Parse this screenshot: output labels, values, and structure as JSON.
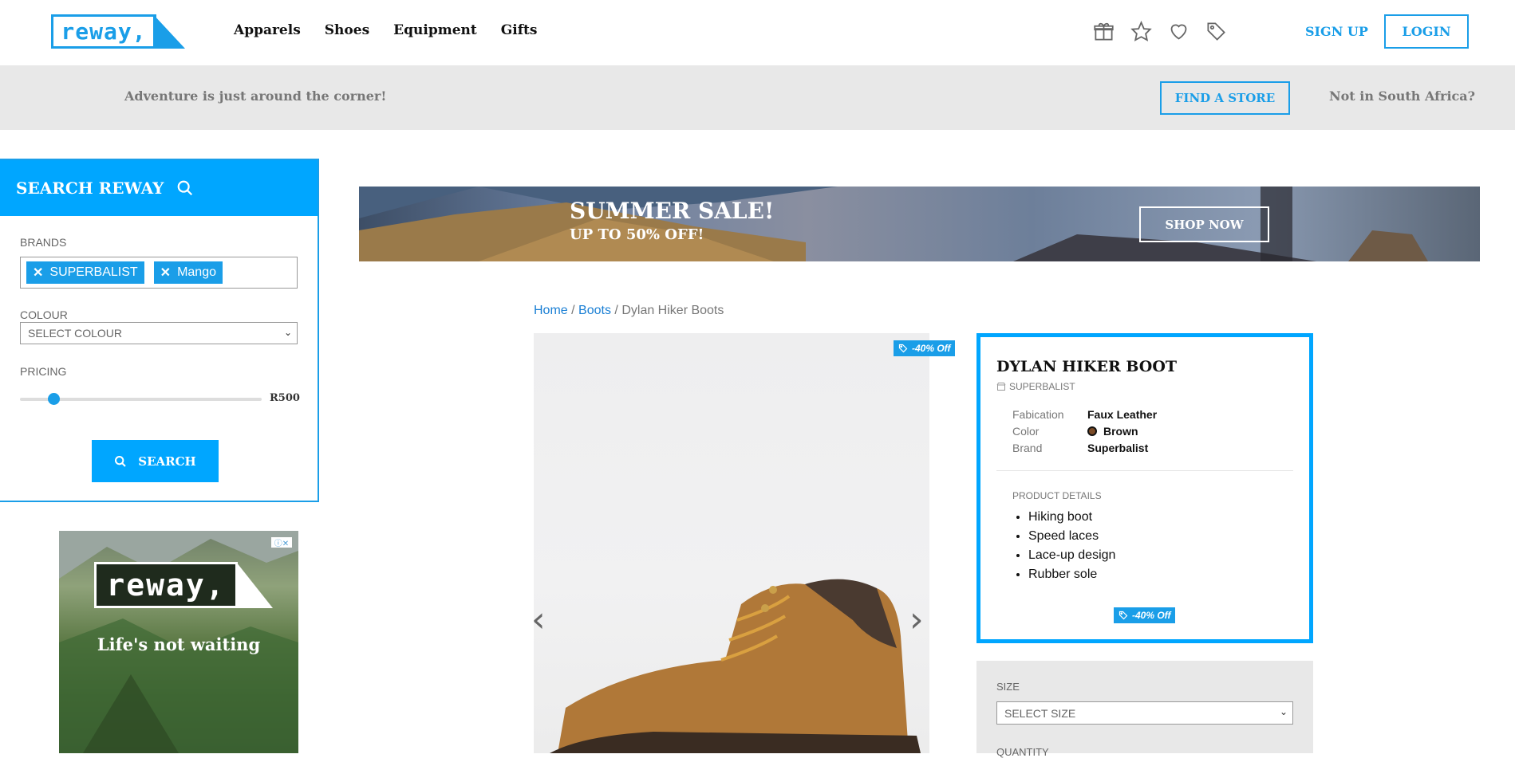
{
  "header": {
    "logo_text": "reway,",
    "nav": [
      "Apparels",
      "Shoes",
      "Equipment",
      "Gifts"
    ],
    "icons": [
      "gift-icon",
      "star-icon",
      "heart-icon",
      "tag-icon"
    ],
    "signup_label": "SIGN UP",
    "login_label": "LOGIN"
  },
  "strip": {
    "tagline": "Adventure is just around the corner!",
    "find_store_label": "FIND A STORE",
    "region_link": "Not in South Africa?"
  },
  "search": {
    "title": "SEARCH REWAY",
    "brands_label": "BRANDS",
    "brand_chips": [
      "SUPERBALIST",
      "Mango"
    ],
    "colour_label": "COLOUR",
    "colour_placeholder": "SELECT COLOUR",
    "pricing_label": "PRICING",
    "price_value": "R500",
    "price_fraction": 0.14,
    "button_label": "SEARCH"
  },
  "ad": {
    "logo_text": "reway,",
    "text": "Life's not waiting"
  },
  "banner": {
    "title": "SUMMER SALE!",
    "subtitle": "UP TO 50% OFF!",
    "button_label": "SHOP NOW"
  },
  "breadcrumb": {
    "home": "Home",
    "category": "Boots",
    "current": "Dylan Hiker Boots",
    "separator": "/"
  },
  "product": {
    "discount_label": "-40% Off",
    "name": "DYLAN HIKER BOOT",
    "brand": "SUPERBALIST",
    "specs": [
      {
        "label": "Fabication",
        "value": "Faux Leather"
      },
      {
        "label": "Color",
        "value": "Brown"
      },
      {
        "label": "Brand",
        "value": "Superbalist"
      }
    ],
    "color_swatch": "#7a4a26",
    "details_label": "PRODUCT DETAILS",
    "details": [
      "Hiking boot",
      "Speed laces",
      "Lace-up design",
      "Rubber sole"
    ],
    "size_label": "SIZE",
    "size_placeholder": "SELECT SIZE",
    "quantity_label": "QUANTITY"
  },
  "colors": {
    "accent": "#00a6ff",
    "brand_blue": "#1a9ee8",
    "strip_bg": "#e8e8e8"
  }
}
